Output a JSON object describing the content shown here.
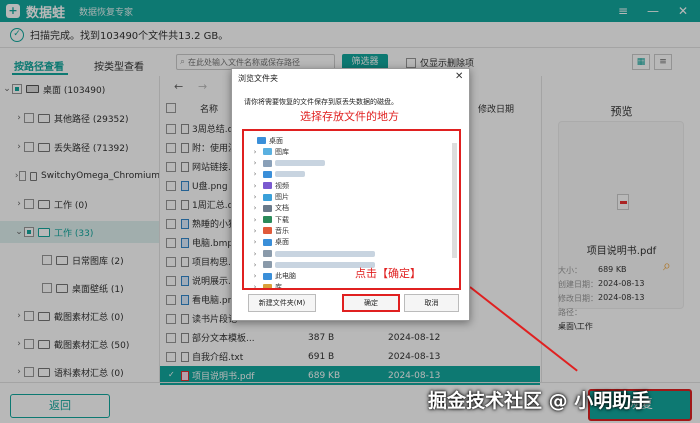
{
  "app": {
    "name": "数据蛙",
    "subtitle": "数据恢复专家",
    "window_controls": [
      "≡",
      "—",
      "✕"
    ]
  },
  "status": {
    "text": "扫描完成。找到103490个文件共13.2 GB。"
  },
  "toolbar": {
    "tab_by_path": "按路径查看",
    "tab_by_type": "按类型查看",
    "search_placeholder": "在此处输入文件名称或保存路径",
    "filter_label": "筛选器",
    "only_deleted_label": "仅显示删除项"
  },
  "sidebar": {
    "items": [
      {
        "label": "桌面 (103490)",
        "expanded": true,
        "check": "partial"
      },
      {
        "label": "其他路径 (29352)",
        "check": "none"
      },
      {
        "label": "丢失路径 (71392)",
        "check": "none"
      },
      {
        "label": "SwitchyOmega_Chromium",
        "check": "none"
      },
      {
        "label": "工作 (0)",
        "check": "none"
      },
      {
        "label": "工作 (33)",
        "check": "partial"
      },
      {
        "label": "日常图库 (2)",
        "check": "none"
      },
      {
        "label": "桌面壁纸 (1)",
        "check": "none"
      },
      {
        "label": "截图素材汇总 (0)",
        "check": "none"
      },
      {
        "label": "截图素材汇总 (50)",
        "check": "none"
      },
      {
        "label": "语料素材汇总 (0)",
        "check": "none"
      }
    ]
  },
  "table": {
    "col_name": "名称",
    "col_modified": "修改日期",
    "rows": [
      {
        "name": "3周总结.do",
        "size": "",
        "date": "2024-07-02",
        "type": "doc"
      },
      {
        "name": "附：使用注",
        "size": "",
        "date": "2024-07-04",
        "type": "doc"
      },
      {
        "name": "网站链接.tx",
        "size": "",
        "date": "2024-07-31",
        "type": "doc"
      },
      {
        "name": "U盘.png",
        "size": "",
        "date": "2024-07-02",
        "type": "img"
      },
      {
        "name": "1周汇总.do",
        "size": "",
        "date": "2024-07-02",
        "type": "doc"
      },
      {
        "name": "熟睡的小猫",
        "size": "",
        "date": "2024-08-13",
        "type": "img"
      },
      {
        "name": "电脑.bmp",
        "size": "",
        "date": "2024-08-13",
        "type": "img"
      },
      {
        "name": "项目构思.d",
        "size": "",
        "date": "2024-08-13",
        "type": "doc"
      },
      {
        "name": "说明展示.p",
        "size": "",
        "date": "2024-08-13",
        "type": "img"
      },
      {
        "name": "看电脑.png",
        "size": "",
        "date": "2024-08-13",
        "type": "img"
      },
      {
        "name": "读书片段记",
        "size": "",
        "date": "2024-08-13",
        "type": "doc"
      },
      {
        "name": "部分文本模板...",
        "size": "387 B",
        "date": "2024-08-12",
        "type": "doc"
      },
      {
        "name": "自我介绍.txt",
        "size": "691 B",
        "date": "2024-08-13",
        "type": "doc"
      },
      {
        "name": "项目说明书.pdf",
        "size": "689 KB",
        "date": "2024-08-13",
        "type": "pdf",
        "selected": true
      }
    ],
    "right_dates": [
      "2024-07-02",
      "2024-07-04",
      "2024-07-31",
      "2024-07-02",
      "2024-07-02",
      "2024-08-13",
      "2024-08-13",
      "2024-08-13",
      "2024-08-13",
      "2024-08-13",
      "2024-08-13"
    ]
  },
  "preview": {
    "title": "预览",
    "file_name": "项目说明书.pdf",
    "size_label": "大小：",
    "size_value": "689 KB",
    "created_label": "创建日期：",
    "created_value": "2024-08-13",
    "modified_label": "修改日期：",
    "modified_value": "2024-08-13",
    "path_label": "路径：",
    "path_value": "桌面\\工作"
  },
  "bottom": {
    "back_label": "返回",
    "recover_label": "恢复"
  },
  "dialog": {
    "title": "浏览文件夹",
    "close": "✕",
    "description": "请你将需要恢复的文件保存到原丢失数据的磁盘。",
    "note_location": "选择存放文件的地方",
    "note_click": "点击【确定】",
    "tree": [
      {
        "label": "桌面",
        "icon": "desktop",
        "level": 0
      },
      {
        "label": "图库",
        "icon": "gallery",
        "level": 1
      },
      {
        "label": "",
        "icon": "user",
        "level": 1
      },
      {
        "label": "",
        "icon": "pc",
        "level": 1
      },
      {
        "label": "视频",
        "icon": "video",
        "level": 1
      },
      {
        "label": "图片",
        "icon": "picture",
        "level": 1
      },
      {
        "label": "文档",
        "icon": "doc",
        "level": 1
      },
      {
        "label": "下载",
        "icon": "download",
        "level": 1
      },
      {
        "label": "音乐",
        "icon": "music",
        "level": 1
      },
      {
        "label": "桌面",
        "icon": "desktop",
        "level": 1
      },
      {
        "label": "",
        "icon": "drive",
        "level": 1
      },
      {
        "label": "",
        "icon": "drive",
        "level": 1
      },
      {
        "label": "此电脑",
        "icon": "pc",
        "level": 1
      },
      {
        "label": "库",
        "icon": "library",
        "level": 1
      }
    ],
    "new_folder_label": "新建文件夹(M)",
    "ok_label": "确定",
    "cancel_label": "取消"
  },
  "watermark": "掘金技术社区 @ 小明助手",
  "colors": {
    "accent": "#13a89e",
    "annotation_red": "#e02020"
  }
}
